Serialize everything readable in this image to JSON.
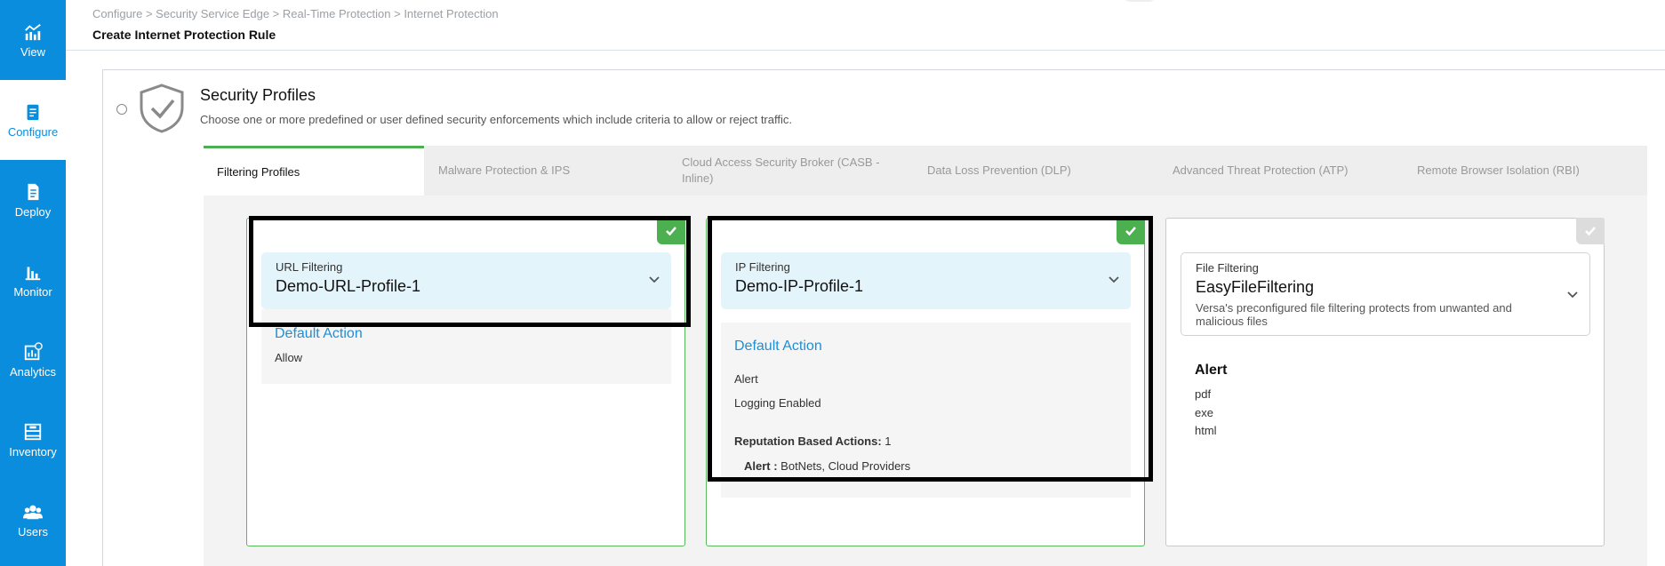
{
  "sidebar": {
    "items": [
      {
        "label": "View",
        "icon": "chart-icon"
      },
      {
        "label": "Configure",
        "icon": "clipboard-icon",
        "active": true
      },
      {
        "label": "Deploy",
        "icon": "document-icon"
      },
      {
        "label": "Monitor",
        "icon": "bar-chart-icon"
      },
      {
        "label": "Analytics",
        "icon": "analytics-icon"
      },
      {
        "label": "Inventory",
        "icon": "inventory-icon"
      },
      {
        "label": "Users",
        "icon": "users-icon"
      }
    ]
  },
  "header": {
    "breadcrumb": "Configure > Security Service Edge > Real-Time Protection > Internet Protection",
    "title": "Create Internet Protection Rule"
  },
  "section": {
    "title": "Security Profiles",
    "description": "Choose one or more predefined or user defined security enforcements which include criteria to allow or reject traffic."
  },
  "tabs": [
    {
      "label": "Filtering Profiles",
      "active": true
    },
    {
      "label": "Malware Protection & IPS"
    },
    {
      "label": "Cloud Access Security Broker (CASB - Inline)"
    },
    {
      "label": "Data Loss Prevention (DLP)"
    },
    {
      "label": "Advanced Threat Protection (ATP)"
    },
    {
      "label": "Remote Browser Isolation (RBI)"
    }
  ],
  "cards": {
    "url": {
      "label": "URL Filtering",
      "value": "Demo-URL-Profile-1",
      "default_action_title": "Default Action",
      "action": "Allow",
      "selected": true
    },
    "ip": {
      "label": "IP Filtering",
      "value": "Demo-IP-Profile-1",
      "default_action_title": "Default Action",
      "action": "Alert",
      "logging": "Logging Enabled",
      "reputation_label": "Reputation Based Actions:",
      "reputation_count": " 1",
      "alert_label": "Alert :",
      "alert_value": " BotNets, Cloud Providers",
      "selected": true
    },
    "file": {
      "label": "File Filtering",
      "value": "EasyFileFiltering",
      "description": "Versa's preconfigured file filtering protects from unwanted and malicious files",
      "alert_title": "Alert",
      "file_types": [
        "pdf",
        "exe",
        "html"
      ],
      "selected": false
    }
  },
  "colors": {
    "sidebar": "#0a8ddc",
    "accent_green": "#4caf50",
    "link_blue": "#1e8fd5",
    "selector_bg": "#e3f4fb"
  }
}
